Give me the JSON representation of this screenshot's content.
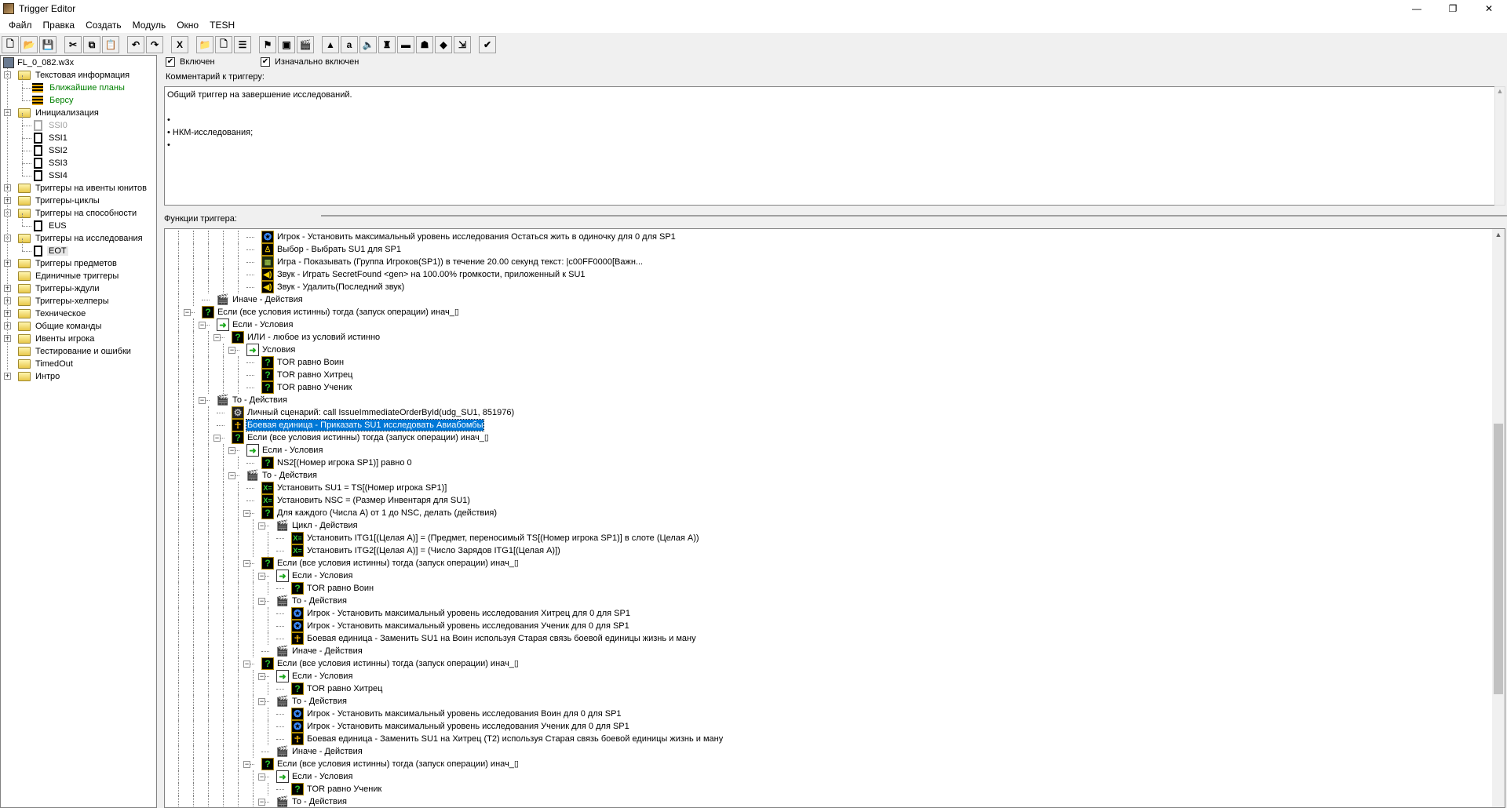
{
  "window": {
    "title": "Trigger Editor",
    "controls": [
      "—",
      "❐",
      "✕"
    ]
  },
  "menu": [
    "Файл",
    "Правка",
    "Создать",
    "Модуль",
    "Окно",
    "TESH"
  ],
  "toolbar": [
    {
      "name": "new",
      "glyph": "🗋"
    },
    {
      "name": "open",
      "glyph": "📂"
    },
    {
      "name": "save",
      "glyph": "💾"
    },
    {
      "gap": true
    },
    {
      "name": "cut",
      "glyph": "✂"
    },
    {
      "name": "copy",
      "glyph": "⧉"
    },
    {
      "name": "paste",
      "glyph": "📋"
    },
    {
      "gap": true
    },
    {
      "name": "undo",
      "glyph": "↶"
    },
    {
      "name": "redo",
      "glyph": "↷"
    },
    {
      "gap": true
    },
    {
      "name": "delete",
      "glyph": "X"
    },
    {
      "gap": true
    },
    {
      "name": "new-category",
      "glyph": "📁"
    },
    {
      "name": "new-trigger",
      "glyph": "🗋"
    },
    {
      "name": "new-comment",
      "glyph": "☰"
    },
    {
      "gap": true
    },
    {
      "name": "new-event",
      "glyph": "⚑"
    },
    {
      "name": "new-condition",
      "glyph": "▣"
    },
    {
      "name": "new-action",
      "glyph": "🎬"
    },
    {
      "gap": true
    },
    {
      "name": "terrain-editor",
      "glyph": "▲"
    },
    {
      "name": "trigger-editor",
      "glyph": "a"
    },
    {
      "name": "sound-editor",
      "glyph": "🔈"
    },
    {
      "name": "object-editor",
      "glyph": "♜"
    },
    {
      "name": "campaign-editor",
      "glyph": "▬"
    },
    {
      "name": "ai-editor",
      "glyph": "☗"
    },
    {
      "name": "object-manager",
      "glyph": "◆"
    },
    {
      "name": "import-manager",
      "glyph": "⇲"
    },
    {
      "gap": true
    },
    {
      "name": "test-map",
      "glyph": "✔"
    }
  ],
  "map_tree": {
    "root": "FL_0_082.w3x",
    "items": [
      {
        "label": "Текстовая информация",
        "type": "folder",
        "depth": 1,
        "expander": "−"
      },
      {
        "label": "Ближайшие планы",
        "type": "plan",
        "depth": 2,
        "color": "#008000"
      },
      {
        "label": "Берсу",
        "type": "plan",
        "depth": 2,
        "color": "#008000"
      },
      {
        "label": "Инициализация",
        "type": "folder",
        "depth": 1,
        "expander": "−"
      },
      {
        "label": "SSI0",
        "type": "trigger-disabled",
        "depth": 2,
        "color": "#a0a0a0"
      },
      {
        "label": "SSI1",
        "type": "trigger",
        "depth": 2
      },
      {
        "label": "SSI2",
        "type": "trigger",
        "depth": 2
      },
      {
        "label": "SSI3",
        "type": "trigger",
        "depth": 2
      },
      {
        "label": "SSI4",
        "type": "trigger",
        "depth": 2
      },
      {
        "label": "Триггеры на ивенты юнитов",
        "type": "folder",
        "depth": 1,
        "expander": "+"
      },
      {
        "label": "Триггеры-циклы",
        "type": "folder",
        "depth": 1,
        "expander": "+"
      },
      {
        "label": "Триггеры на способности",
        "type": "folder",
        "depth": 1,
        "expander": "−"
      },
      {
        "label": "EUS",
        "type": "trigger",
        "depth": 2
      },
      {
        "label": "Триггеры на исследования",
        "type": "folder",
        "depth": 1,
        "expander": "−"
      },
      {
        "label": "EOT",
        "type": "trigger",
        "depth": 2,
        "selected": true
      },
      {
        "label": "Триггеры предметов",
        "type": "folder",
        "depth": 1,
        "expander": "+"
      },
      {
        "label": "Единичные триггеры",
        "type": "folder",
        "depth": 1
      },
      {
        "label": "Триггеры-ждули",
        "type": "folder",
        "depth": 1,
        "expander": "+"
      },
      {
        "label": "Триггеры-хелперы",
        "type": "folder",
        "depth": 1,
        "expander": "+"
      },
      {
        "label": "Техническое",
        "type": "folder",
        "depth": 1,
        "expander": "+"
      },
      {
        "label": "Общие команды",
        "type": "folder",
        "depth": 1,
        "expander": "+"
      },
      {
        "label": "Ивенты игрока",
        "type": "folder",
        "depth": 1,
        "expander": "+"
      },
      {
        "label": "Тестирование и ошибки",
        "type": "folder",
        "depth": 1
      },
      {
        "label": "TimedOut",
        "type": "folder",
        "depth": 1
      },
      {
        "label": "Интро",
        "type": "folder",
        "depth": 1,
        "expander": "+"
      }
    ]
  },
  "trigger": {
    "enabled_label": "Включен",
    "enabled": true,
    "initially_on_label": "Изначально включен",
    "initially_on": true,
    "comment_label": "Комментарий к триггеру:",
    "comment": "Общий триггер на завершение исследований.\n\n•\n• НКМ-исследования;\n•",
    "functions_label": "Функции триггера:"
  },
  "functions": [
    {
      "d": 4,
      "i": "player",
      "t": "Игрок - Установить максимальный уровень исследования Остаться жить в одиночку  для 0 для SP1"
    },
    {
      "d": 4,
      "i": "sel",
      "t": "Выбор - Выбрать SU1 для SP1"
    },
    {
      "d": 4,
      "i": "game",
      "t": "Игра - Показывать (Группа Игроков(SP1)) в течение 20.00 секунд текст: |c00FF0000[Важн..."
    },
    {
      "d": 4,
      "i": "sound",
      "t": "Звук - Играть SecretFound <gen> на 100.00% громкости, приложенный к SU1"
    },
    {
      "d": 4,
      "i": "sound",
      "t": "Звук - Удалить(Последний звук)"
    },
    {
      "d": 1,
      "i": "act",
      "t": "Иначе - Действия"
    },
    {
      "d": 0,
      "i": "q",
      "t": "Если (все условия истинны) тогда (запуск операции) инач_▯",
      "e": true
    },
    {
      "d": 1,
      "i": "cond",
      "t": "Если - Условия",
      "e": true
    },
    {
      "d": 2,
      "i": "q",
      "t": "ИЛИ - любое из условий истинно",
      "e": true
    },
    {
      "d": 3,
      "i": "cond",
      "t": "Условия",
      "e": true
    },
    {
      "d": 4,
      "i": "q",
      "t": "TOR равно Воин"
    },
    {
      "d": 4,
      "i": "q",
      "t": "TOR равно Хитрец"
    },
    {
      "d": 4,
      "i": "q",
      "t": "TOR равно Ученик"
    },
    {
      "d": 1,
      "i": "act",
      "t": "То - Действия",
      "e": true
    },
    {
      "d": 2,
      "i": "script",
      "t": "Личный сценарий: call IssueImmediateOrderById(udg_SU1, 851976)"
    },
    {
      "d": 2,
      "i": "unit",
      "t": "Боевая единица - Приказать SU1 исследовать Авиабомбы",
      "sel": true
    },
    {
      "d": 2,
      "i": "q",
      "t": "Если (все условия истинны) тогда (запуск операции) инач_▯",
      "e": true
    },
    {
      "d": 3,
      "i": "cond",
      "t": "Если - Условия",
      "e": true
    },
    {
      "d": 4,
      "i": "q",
      "t": "NS2[(Номер игрока SP1)] равно 0"
    },
    {
      "d": 3,
      "i": "act",
      "t": "То - Действия",
      "e": true
    },
    {
      "d": 4,
      "i": "var",
      "t": "Установить SU1 = TS[(Номер игрока SP1)]"
    },
    {
      "d": 4,
      "i": "var",
      "t": "Установить NSC = (Размер Инвентаря для SU1)"
    },
    {
      "d": 4,
      "i": "q",
      "t": "Для каждого (Числа A) от 1 до NSC, делать (действия)",
      "e": true
    },
    {
      "d": 5,
      "i": "act",
      "t": "Цикл - Действия",
      "e": true
    },
    {
      "d": 6,
      "i": "var",
      "t": "Установить ITG1[(Целая A)] = (Предмет, переносимый TS[(Номер игрока SP1)] в слоте (Целая A))"
    },
    {
      "d": 6,
      "i": "var",
      "t": "Установить ITG2[(Целая A)] = (Число Зарядов ITG1[(Целая A)])"
    },
    {
      "d": 4,
      "i": "q",
      "t": "Если (все условия истинны) тогда (запуск операции) инач_▯",
      "e": true
    },
    {
      "d": 5,
      "i": "cond",
      "t": "Если - Условия",
      "e": true
    },
    {
      "d": 6,
      "i": "q",
      "t": "TOR равно Воин"
    },
    {
      "d": 5,
      "i": "act",
      "t": "То - Действия",
      "e": true
    },
    {
      "d": 6,
      "i": "player",
      "t": "Игрок - Установить максимальный уровень исследования Хитрец  для 0 для SP1"
    },
    {
      "d": 6,
      "i": "player",
      "t": "Игрок - Установить максимальный уровень исследования Ученик  для 0 для SP1"
    },
    {
      "d": 6,
      "i": "unit",
      "t": "Боевая единица - Заменить SU1 на Воин используя Старая связь боевой единицы жизнь и ману"
    },
    {
      "d": 5,
      "i": "act",
      "t": "Иначе - Действия"
    },
    {
      "d": 4,
      "i": "q",
      "t": "Если (все условия истинны) тогда (запуск операции) инач_▯",
      "e": true
    },
    {
      "d": 5,
      "i": "cond",
      "t": "Если - Условия",
      "e": true
    },
    {
      "d": 6,
      "i": "q",
      "t": "TOR равно Хитрец"
    },
    {
      "d": 5,
      "i": "act",
      "t": "То - Действия",
      "e": true
    },
    {
      "d": 6,
      "i": "player",
      "t": "Игрок - Установить максимальный уровень исследования Воин  для 0 для SP1"
    },
    {
      "d": 6,
      "i": "player",
      "t": "Игрок - Установить максимальный уровень исследования Ученик  для 0 для SP1"
    },
    {
      "d": 6,
      "i": "unit",
      "t": "Боевая единица - Заменить SU1 на Хитрец (Т2) используя Старая связь боевой единицы жизнь и ману"
    },
    {
      "d": 5,
      "i": "act",
      "t": "Иначе - Действия"
    },
    {
      "d": 4,
      "i": "q",
      "t": "Если (все условия истинны) тогда (запуск операции) инач_▯",
      "e": true
    },
    {
      "d": 5,
      "i": "cond",
      "t": "Если - Условия",
      "e": true
    },
    {
      "d": 6,
      "i": "q",
      "t": "TOR равно Ученик"
    },
    {
      "d": 5,
      "i": "act",
      "t": "То - Действия",
      "e": true
    }
  ],
  "icon_glyphs": {
    "q": "?",
    "cond": "➜",
    "act": "🎬",
    "var": "X=",
    "player": "✪",
    "unit": "☥",
    "sel": "♙",
    "game": "▦",
    "sound": "◀)",
    "script": "⚙"
  }
}
